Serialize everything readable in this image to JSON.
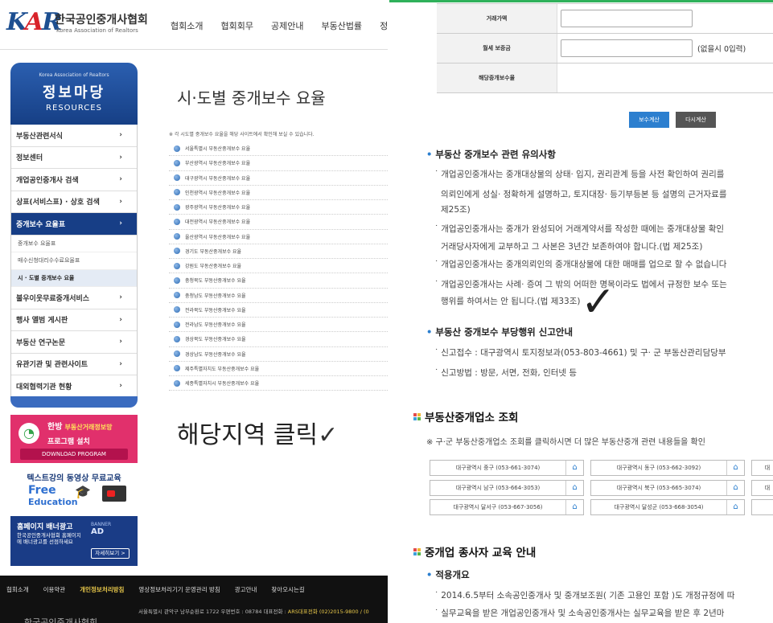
{
  "left": {
    "logo": {
      "mark": "KAR",
      "name_ko": "한국공인중개사협회",
      "name_en": "Korea Association of Realtors"
    },
    "gnb": [
      "협회소개",
      "협회회무",
      "공제안내",
      "부동산법률",
      "정"
    ],
    "lnb_head": {
      "small": "Korea Association of Realtors",
      "title": "정보마당",
      "en": "RESOURCES"
    },
    "lnb_items_top": [
      {
        "label": "부동산관련서식",
        "arrow": "›"
      },
      {
        "label": "정보센터",
        "arrow": "›"
      },
      {
        "label": "개업공인중개사 검색",
        "arrow": "›"
      },
      {
        "label": "상표(서비스표) · 상호 검색",
        "arrow": "›"
      },
      {
        "label": "중개보수 요율표",
        "arrow": "›"
      }
    ],
    "lnb_subs": [
      "중개보수 요율표",
      "매수신청대리수수료요율표",
      "시 · 도별 중개보수 요율"
    ],
    "lnb_items_bottom": [
      {
        "label": "불우이웃무료중개서비스",
        "arrow": "›"
      },
      {
        "label": "행사 앨범 게시판",
        "arrow": "›"
      },
      {
        "label": "부동산 연구논문",
        "arrow": "›"
      },
      {
        "label": "유관기관 및 관련사이트",
        "arrow": "›"
      },
      {
        "label": "대외협력기관 현황",
        "arrow": "›"
      }
    ],
    "banner1": {
      "l1": "한방",
      "l1b": "부동산거래정보망",
      "l2": "프로그램 설치",
      "l3": "DOWNLOAD PROGRAM"
    },
    "banner2": {
      "l1": "텍스트강의 동영상 무료교육",
      "l2": "Free",
      "l3": "Education"
    },
    "banner3": {
      "title": "홈페이지 배너광고",
      "desc": "한국공인중개사협회 홈페이지에 배너광고를 선점하세요",
      "ad_small": "BANNER",
      "ad_big": "AD",
      "button": "자세히보기 >"
    },
    "content_title": "시·도별 중개보수 요율",
    "content_note": "※ 각 시도별 중개보수 요율을 해당 사이트에서 확인해 보실 수 있습니다.",
    "regions": [
      "서울특별시 부동산중개보수 요율",
      "부산광역시 부동산중개보수 요율",
      "대구광역시 부동산중개보수 요율",
      "인천광역시 부동산중개보수 요율",
      "광주광역시 부동산중개보수 요율",
      "대전광역시 부동산중개보수 요율",
      "울산광역시 부동산중개보수 요율",
      "경기도 부동산중개보수 요율",
      "강원도 부동산중개보수 요율",
      "충청북도 부동산중개보수 요율",
      "충청남도 부동산중개보수 요율",
      "전라북도 부동산중개보수 요율",
      "전라남도 부동산중개보수 요율",
      "경상북도 부동산중개보수 요율",
      "경상남도 부동산중개보수 요율",
      "제주특별자치도 부동산중개보수 요율",
      "세종특별자치시 부동산중개보수 요율"
    ],
    "annotation": "해당지역 클릭",
    "annotation_mark": "✓",
    "footer_links": [
      "협회소개",
      "이용약관",
      "개인정보처리방침",
      "영상정보처리기기 운영관리 방침",
      "광고안내",
      "찾아오시는길"
    ],
    "footer_logo": "한국공인중개사협회",
    "footer_addr": "서울특별시 관악구 남부순환로 1722 우편번호 : 08784 대표전화 :",
    "footer_phone": "ARS대표전화 (02)2015-9800 / (0"
  },
  "right": {
    "form_rows": [
      {
        "label": "거래가액",
        "has_input": true,
        "suffix": ""
      },
      {
        "label": "월세 보증금",
        "has_input": true,
        "suffix": "(없을시 0입력)"
      },
      {
        "label": "해당중개보수율",
        "has_input": false,
        "suffix": ""
      }
    ],
    "btn_calc": "보수계산",
    "btn_reset": "다시계산",
    "notice_title": "부동산 중개보수 관련 유의사항",
    "notice_p1_l1": "개업공인중개사는 중개대상물의 상태· 입지, 권리관계 등을 사전 확인하여 권리를",
    "notice_p1_l2": "의뢰인에게 성실· 정확하게 설명하고, 토지대장· 등기부등본 등 설명의 근거자료를",
    "notice_p1_l3": "제25조)",
    "notice_p2_l1": "개업공인중개사는 중개가 완성되어 거래계약서를 작성한 때에는 중개대상물 확인",
    "notice_p2_l2": "거래당사자에게 교부하고 그 사본은 3년간 보존하여야 합니다.(법 제25조)",
    "notice_p3": "개업공인중개사는 중개의뢰인의 중개대상물에 대한 매매를 업으로 할 수 없습니다",
    "notice_p4_l1": "개업공인중개사는 사례· 증여 그 밖의 어떠한 명목이라도 법에서 규정한 보수 또는",
    "notice_p4_l2": "행위를 하여서는 안 됩니다.(법 제33조)",
    "report_title": "부동산 중개보수 부당행위 신고안내",
    "report_p1": "신고접수 : 대구광역시 토지정보과(053-803-4661) 및 구· 군 부동산관리담당부",
    "report_p2": "신고방법 : 방문, 서면, 전화, 인터넷 등",
    "check_mark": "✓",
    "agency_title": "부동산중개업소 조회",
    "agency_note": "※ 구·군 부동산중개업소 조회를 클릭하시면 더 많은 부동산중개 관련 내용들을 확인",
    "agencies": [
      "대구광역시 중구 (053-661-3074)",
      "대구광역시 동구 (053-662-3092)",
      "대구광역시 남구 (053-664-3053)",
      "대구광역시 북구 (053-665-3074)",
      "대구광역시 달서구 (053-667-3056)",
      "대구광역시 달성군 (053-668-3054)"
    ],
    "agency_cut": [
      "대",
      "대"
    ],
    "edu_title": "중개업 종사자 교육 안내",
    "edu_sub": "적용개요",
    "edu_p1": "2014.6.5부터 소속공인중개사 및 중개보조원( 기존 고용인 포함 )도 개정규정에 따",
    "edu_p2": "실무교육을 받은 개업공인중개사 및 소속공인중개사는 실무교육을 받은 후 2년마"
  },
  "colors": {
    "brand_blue": "#173e86",
    "accent_blue": "#2c7fcf",
    "green_line": "#2fb15b",
    "banner_pink": "#e1306c"
  }
}
